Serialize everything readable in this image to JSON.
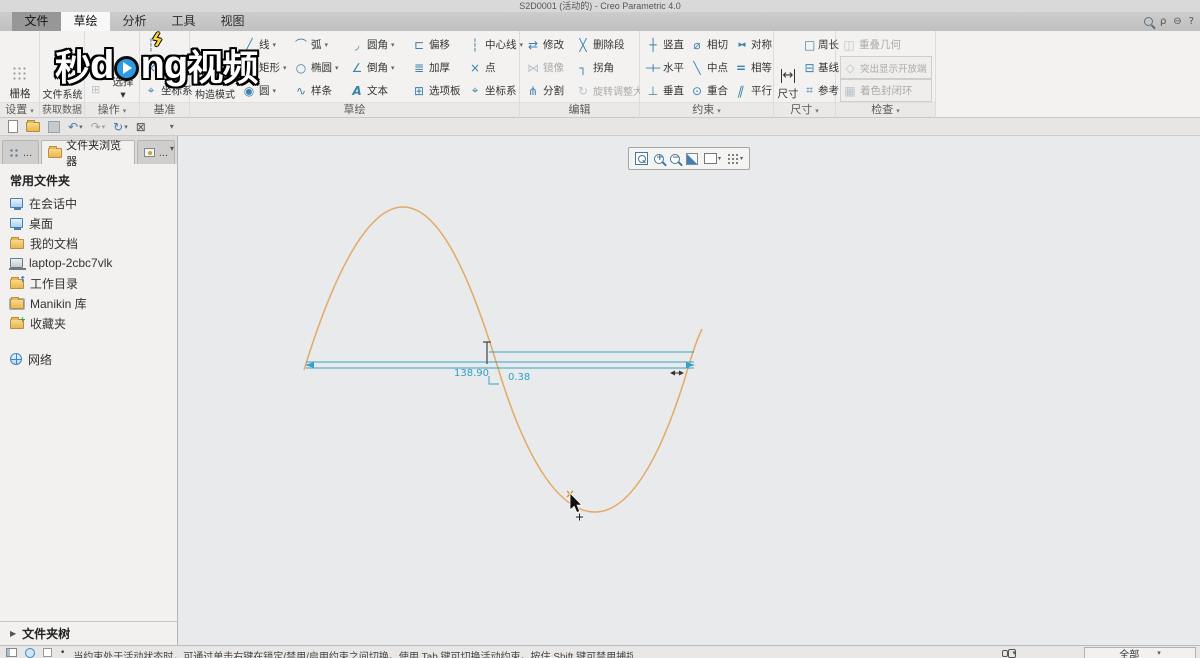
{
  "window": {
    "title": "S2D0001 (活动的) - Creo Parametric 4.0"
  },
  "tabs": [
    "文件",
    "草绘",
    "分析",
    "工具",
    "视图"
  ],
  "ribbon": {
    "settings": {
      "label": "设置",
      "grid": "栅格"
    },
    "get_data": {
      "label": "获取数据",
      "file_system": "文件系统"
    },
    "operations": {
      "label": "操作",
      "select": "选择"
    },
    "datum": {
      "label": "基准",
      "centerline": "中心线",
      "point": "点",
      "csys": "坐标系"
    },
    "sketch": {
      "label": "草绘",
      "construction_mode": "构造模式",
      "r1": [
        "线",
        "弧",
        "圆角",
        "偏移",
        "中心线"
      ],
      "r2": [
        "矩形",
        "椭圆",
        "倒角",
        "加厚",
        "点"
      ],
      "r3": [
        "圆",
        "样条",
        "文本",
        "选项板",
        "坐标系"
      ]
    },
    "edit": {
      "label": "编辑",
      "modify": "修改",
      "delete_segment": "删除段",
      "mirror": "镜像",
      "corner": "拐角",
      "divide": "分割",
      "rotate_resize": "旋转调整大小"
    },
    "constrain": {
      "label": "约束",
      "vertical": "竖直",
      "tangent": "相切",
      "symmetric": "对称",
      "horizontal": "水平",
      "midpoint": "中点",
      "equal": "相等",
      "perpendicular": "垂直",
      "coincident": "重合",
      "parallel": "平行"
    },
    "dimension": {
      "label": "尺寸",
      "dimension": "尺寸",
      "perimeter": "周长",
      "baseline": "基线",
      "reference": "参考"
    },
    "inspect": {
      "label": "检查",
      "overlapping_geometry": "重叠几何",
      "highlight_open_ends": "突出显示开放端",
      "shade_closed_loops": "着色封闭环"
    }
  },
  "watermark": {
    "char1": "秒",
    "char2": "d",
    "char3": "ng",
    "char4": "视频"
  },
  "navigator": {
    "tab_browser": "文件夹浏览器",
    "tab1_more": "...",
    "tab3_more": "...",
    "header": "常用文件夹",
    "items": [
      "在会话中",
      "桌面",
      "我的文档",
      "laptop-2cbc7vlk",
      "工作目录",
      "Manikin 库",
      "收藏夹"
    ],
    "network": "网络",
    "folder_tree": "文件夹树"
  },
  "canvas": {
    "dim_length": "138.90",
    "dim_value": "0.38"
  },
  "status": {
    "message": "当约束处于活动状态时，可通过单击右键在锁定/禁用/启用约束之间切换。使用 Tab 键可切换活动约束。按住 Shift 键可禁用捕捉到新约束。",
    "filter_all": "全部"
  },
  "colors": {
    "accent_blue": "#3b82ad",
    "curve": "#e3a967",
    "dimension": "#35a2c8"
  },
  "icons": {
    "undo": "↶",
    "redo": "↷",
    "regenerate": "↻",
    "close_window": "⊠",
    "caret": "▾",
    "expand_right": "▶",
    "line": "╱",
    "arc": "⌒",
    "fillet": "◞",
    "offset": "⊏",
    "centerline": "┆",
    "rectangle": "▭",
    "ellipse": "○",
    "chamfer": "∠",
    "thicken": "≣",
    "point": "×",
    "circle": "◉",
    "spline": "∿",
    "text": "A",
    "palette": "⊞",
    "csys": "⌖",
    "modify": "⇄",
    "delete_segment": "╳",
    "mirror": "⋈",
    "corner": "┐",
    "divide": "⋔",
    "rotate_resize": "↻",
    "vertical": "┼",
    "tangent": "⌀",
    "symmetric": "▸◂",
    "horizontal": "┼",
    "midpoint": "╲",
    "equal": "=",
    "perpendicular": "⊥",
    "coincident": "⊙",
    "parallel": "∥",
    "dim_arrow": "↔",
    "perimeter": "□",
    "baseline": "⊟",
    "reference": "⌗",
    "overlap": "◫",
    "open_ends": "◇",
    "closed_loops": "▦",
    "rho": "ρ",
    "minus_circle": "⊖",
    "question": "?",
    "bullet": "•",
    "plus": "+",
    "minus": "−"
  }
}
